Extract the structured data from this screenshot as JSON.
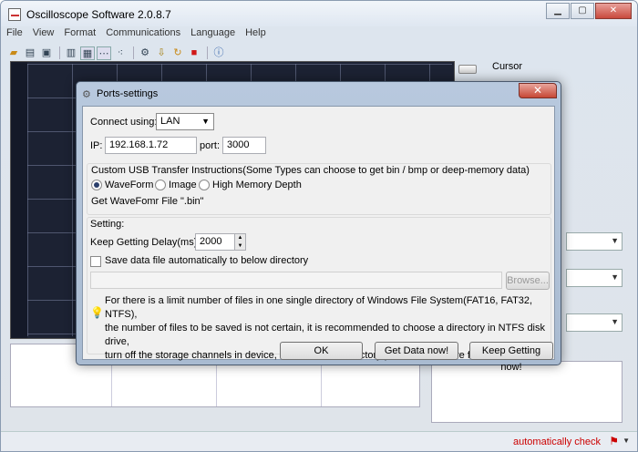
{
  "app": {
    "title": "Oscilloscope Software 2.0.8.7",
    "menu": [
      "File",
      "View",
      "Format",
      "Communications",
      "Language",
      "Help"
    ],
    "cursor_label": "Cursor",
    "status_text": "automatically check"
  },
  "dialog": {
    "title": "Ports-settings",
    "connect_label": "Connect using:",
    "connect_value": "LAN",
    "ip_label": "IP:",
    "ip_value": "192.168.1.72",
    "port_label": "port:",
    "port_value": "3000",
    "usb_group_label": "Custom USB Transfer Instructions(Some Types can choose to get bin / bmp or deep-memory data)",
    "radio_waveform": "WaveForm",
    "radio_image": "Image",
    "radio_high_memory": "High Memory Depth",
    "file_hint": "Get WaveFomr File \".bin\"",
    "setting_label": "Setting:",
    "delay_label": "Keep Getting Delay(ms):",
    "delay_value": "2000",
    "save_checkbox_label": "Save data file automatically to below directory",
    "browse_label": "Browse...",
    "notice_line1": "For there is a limit number of files in one single directory of Windows File System(FAT16, FAT32, NTFS),",
    "notice_line2": "the number of  files to be saved is not certain,  it is recommended to choose a directory in NTFS disk drive,",
    "notice_line3": "turn off the storage channels in device, and use short directory path to save more files.",
    "ok_label": "OK",
    "get_data_label": "Get Data now!",
    "keep_getting_label": "Keep Getting now!"
  }
}
